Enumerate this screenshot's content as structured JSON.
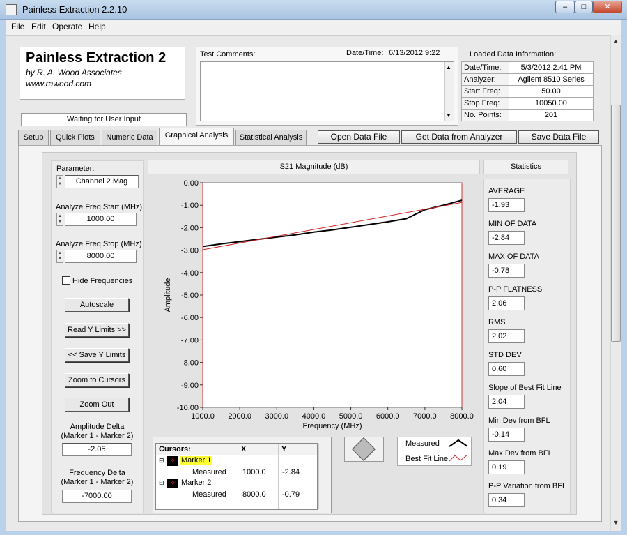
{
  "window": {
    "title": "Painless Extraction 2.2.10"
  },
  "menu": [
    "File",
    "Edit",
    "Operate",
    "Help"
  ],
  "branding": {
    "title": "Painless Extraction 2",
    "company": "by R. A. Wood Associates",
    "url": "www.rawood.com"
  },
  "status": "Waiting for User Input",
  "comments": {
    "label": "Test Comments:",
    "datetime_label": "Date/Time:",
    "datetime_value": "6/13/2012  9:22"
  },
  "loaded": {
    "heading": "Loaded Data Information:",
    "rows": [
      {
        "label": "Date/Time:",
        "value": "5/3/2012 2:41 PM"
      },
      {
        "label": "Analyzer:",
        "value": "Agilent 8510 Series"
      },
      {
        "label": "Start Freq:",
        "value": "50.00"
      },
      {
        "label": "Stop Freq:",
        "value": "10050.00"
      },
      {
        "label": "No. Points:",
        "value": "201"
      }
    ]
  },
  "tabs": [
    "Setup",
    "Quick Plots",
    "Numeric Data",
    "Graphical Analysis",
    "Statistical Analysis"
  ],
  "active_tab": "Graphical Analysis",
  "actions": {
    "open": "Open Data File",
    "get": "Get Data from Analyzer",
    "save": "Save Data File"
  },
  "controls": {
    "parameter_label": "Parameter:",
    "parameter_value": "Channel 2 Mag",
    "start_label": "Analyze Freq Start (MHz)",
    "start_value": "1000.00",
    "stop_label": "Analyze Freq Stop (MHz)",
    "stop_value": "8000.00",
    "hide_freq_label": "Hide Frequencies",
    "hide_freq_checked": false,
    "autoscale": "Autoscale",
    "read_y": "Read Y Limits >>",
    "save_y": "<< Save Y Limits",
    "zoom_cursors": "Zoom to Cursors",
    "zoom_out": "Zoom Out",
    "amp_delta_label1": "Amplitude Delta",
    "amp_delta_label2": "(Marker 1 - Marker 2)",
    "amp_delta_value": "-2.05",
    "freq_delta_label1": "Frequency Delta",
    "freq_delta_label2": "(Marker 1 - Marker 2)",
    "freq_delta_value": "-7000.00"
  },
  "chart_data": {
    "type": "line",
    "title": "S21 Magnitude (dB)",
    "xlabel": "Frequency (MHz)",
    "ylabel": "Amplitude",
    "xlim": [
      1000,
      8000
    ],
    "ylim": [
      -10,
      0
    ],
    "x_ticks": [
      "1000.0",
      "2000.0",
      "3000.0",
      "4000.0",
      "5000.0",
      "6000.0",
      "7000.0",
      "8000.0"
    ],
    "y_ticks": [
      "0.00",
      "-1.00",
      "-2.00",
      "-3.00",
      "-4.00",
      "-5.00",
      "-6.00",
      "-7.00",
      "-8.00",
      "-9.00",
      "-10.00"
    ],
    "series": [
      {
        "name": "Measured",
        "color": "#000000",
        "x": [
          1000,
          1500,
          2000,
          2500,
          3000,
          3500,
          4000,
          4500,
          5000,
          5500,
          6000,
          6500,
          7000,
          7500,
          8000
        ],
        "y": [
          -2.84,
          -2.72,
          -2.62,
          -2.52,
          -2.42,
          -2.32,
          -2.2,
          -2.1,
          -1.98,
          -1.86,
          -1.74,
          -1.6,
          -1.2,
          -1.0,
          -0.78
        ]
      },
      {
        "name": "Best Fit Line",
        "color": "#cc2222",
        "x": [
          1000,
          8000
        ],
        "y": [
          -2.98,
          -0.88
        ]
      }
    ],
    "cursor_lines": [
      1000,
      8000
    ],
    "legend_position": "bottom-right"
  },
  "cursors": {
    "headers": [
      "Cursors:",
      "X",
      "Y"
    ],
    "rows": [
      {
        "name": "Marker 1",
        "sub": "Measured",
        "x": "1000.0",
        "y": "-2.84"
      },
      {
        "name": "Marker 2",
        "sub": "Measured",
        "x": "8000.0",
        "y": "-0.79"
      }
    ]
  },
  "statistics": {
    "heading": "Statistics",
    "items": [
      {
        "label": "AVERAGE",
        "value": "-1.93"
      },
      {
        "label": "MIN OF DATA",
        "value": "-2.84"
      },
      {
        "label": "MAX OF DATA",
        "value": "-0.78"
      },
      {
        "label": "P-P FLATNESS",
        "value": "2.06"
      },
      {
        "label": "RMS",
        "value": "2.02"
      },
      {
        "label": "STD DEV",
        "value": "0.60"
      },
      {
        "label": "Slope of Best Fit Line",
        "value": "2.04"
      },
      {
        "label": "Min Dev from BFL",
        "value": "-0.14"
      },
      {
        "label": "Max Dev from BFL",
        "value": "0.19"
      },
      {
        "label": "P-P Variation from BFL",
        "value": "0.34"
      }
    ]
  }
}
